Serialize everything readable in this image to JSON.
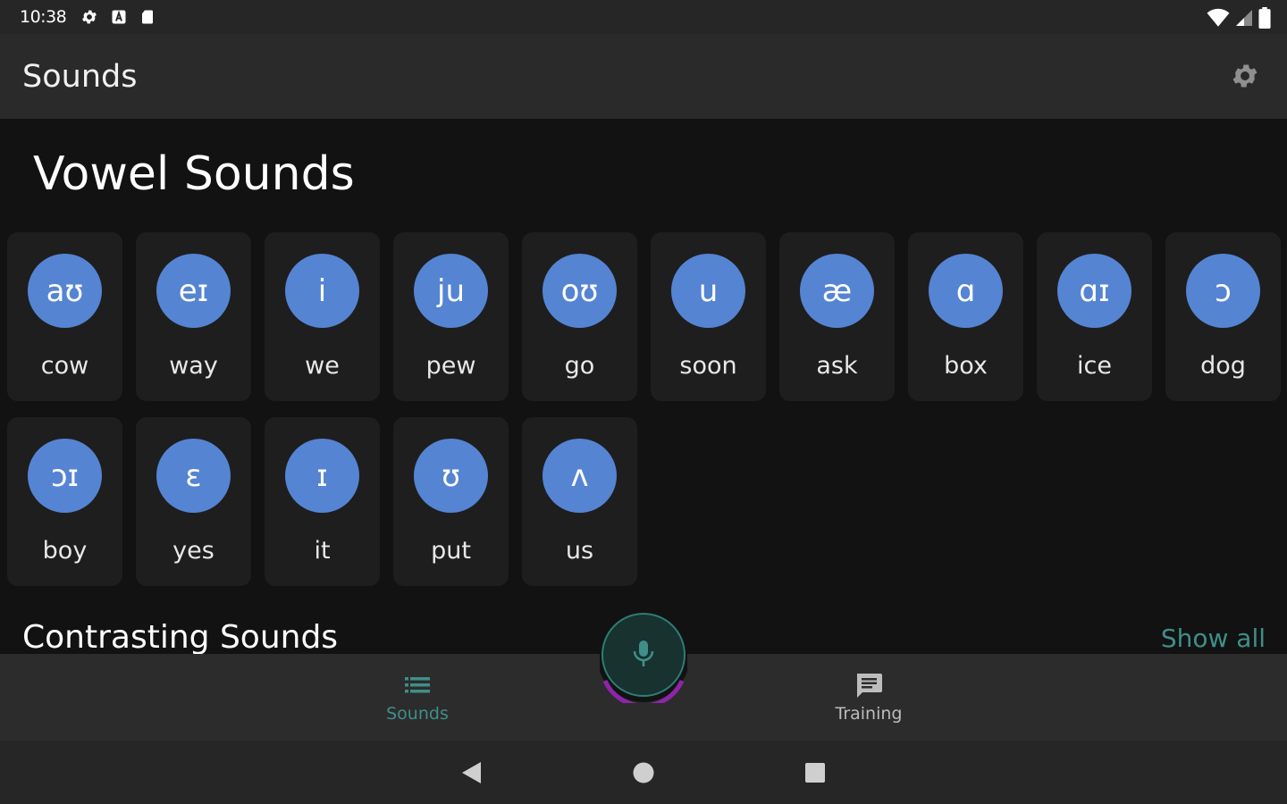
{
  "status_bar": {
    "time": "10:38",
    "icons_left": [
      "gear-icon",
      "a-box-icon",
      "sd-card-icon"
    ],
    "icons_right": [
      "wifi-icon",
      "cell-signal-icon",
      "battery-icon"
    ]
  },
  "app_bar": {
    "title": "Sounds",
    "settings_icon": "gear-icon"
  },
  "vowels": {
    "title": "Vowel Sounds",
    "items": [
      {
        "symbol": "aʊ",
        "word": "cow"
      },
      {
        "symbol": "eɪ",
        "word": "way"
      },
      {
        "symbol": "i",
        "word": "we"
      },
      {
        "symbol": "ju",
        "word": "pew"
      },
      {
        "symbol": "oʊ",
        "word": "go"
      },
      {
        "symbol": "u",
        "word": "soon"
      },
      {
        "symbol": "æ",
        "word": "ask"
      },
      {
        "symbol": "ɑ",
        "word": "box"
      },
      {
        "symbol": "ɑɪ",
        "word": "ice"
      },
      {
        "symbol": "ɔ",
        "word": "dog"
      },
      {
        "symbol": "ɔɪ",
        "word": "boy"
      },
      {
        "symbol": "ɛ",
        "word": "yes"
      },
      {
        "symbol": "ɪ",
        "word": "it"
      },
      {
        "symbol": "ʊ",
        "word": "put"
      },
      {
        "symbol": "ʌ",
        "word": "us"
      }
    ]
  },
  "contrasting": {
    "title": "Contrasting Sounds",
    "show_all": "Show all"
  },
  "bottom_nav": {
    "items": [
      {
        "label": "Sounds",
        "icon": "list-icon",
        "active": true
      },
      {
        "label": "Training",
        "icon": "chat-icon",
        "active": false
      }
    ],
    "mic_icon": "microphone-icon"
  },
  "colors": {
    "accent": "#3f8f88",
    "bubble": "#5584d3",
    "mic_ring": "#8e24aa",
    "background": "#121212"
  }
}
